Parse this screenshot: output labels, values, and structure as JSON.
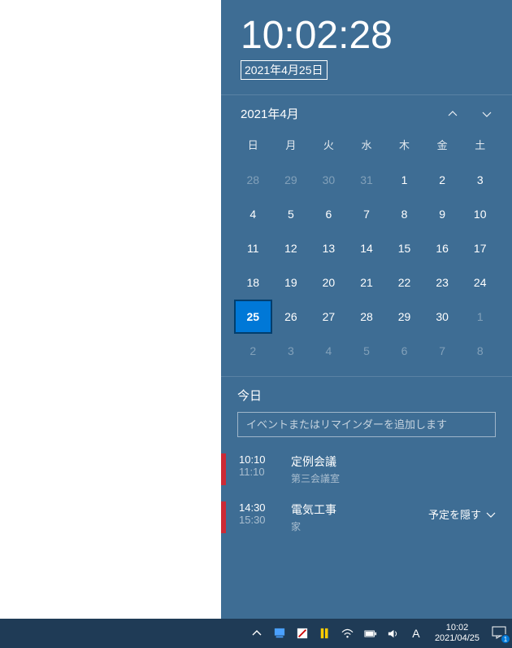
{
  "clock": {
    "time": "10:02:28",
    "date": "2021年4月25日"
  },
  "calendar": {
    "month_label": "2021年4月",
    "weekdays": [
      "日",
      "月",
      "火",
      "水",
      "木",
      "金",
      "土"
    ],
    "cells": [
      {
        "n": "28",
        "dim": true
      },
      {
        "n": "29",
        "dim": true
      },
      {
        "n": "30",
        "dim": true
      },
      {
        "n": "31",
        "dim": true
      },
      {
        "n": "1"
      },
      {
        "n": "2"
      },
      {
        "n": "3"
      },
      {
        "n": "4"
      },
      {
        "n": "5"
      },
      {
        "n": "6"
      },
      {
        "n": "7"
      },
      {
        "n": "8"
      },
      {
        "n": "9"
      },
      {
        "n": "10"
      },
      {
        "n": "11"
      },
      {
        "n": "12"
      },
      {
        "n": "13"
      },
      {
        "n": "14"
      },
      {
        "n": "15"
      },
      {
        "n": "16"
      },
      {
        "n": "17"
      },
      {
        "n": "18"
      },
      {
        "n": "19"
      },
      {
        "n": "20"
      },
      {
        "n": "21"
      },
      {
        "n": "22"
      },
      {
        "n": "23"
      },
      {
        "n": "24"
      },
      {
        "n": "25",
        "today": true
      },
      {
        "n": "26"
      },
      {
        "n": "27"
      },
      {
        "n": "28"
      },
      {
        "n": "29"
      },
      {
        "n": "30"
      },
      {
        "n": "1",
        "dim": true
      },
      {
        "n": "2",
        "dim": true
      },
      {
        "n": "3",
        "dim": true
      },
      {
        "n": "4",
        "dim": true
      },
      {
        "n": "5",
        "dim": true
      },
      {
        "n": "6",
        "dim": true
      },
      {
        "n": "7",
        "dim": true
      },
      {
        "n": "8",
        "dim": true
      }
    ]
  },
  "agenda": {
    "label": "今日",
    "input_placeholder": "イベントまたはリマインダーを追加します",
    "events": [
      {
        "start": "10:10",
        "end": "11:10",
        "title": "定例会議",
        "location": "第三会議室"
      },
      {
        "start": "14:30",
        "end": "15:30",
        "title": "電気工事",
        "location": "家"
      }
    ],
    "hide_label": "予定を隠す"
  },
  "taskbar": {
    "time": "10:02",
    "date": "2021/04/25",
    "ime": "A",
    "notif_count": "1"
  }
}
